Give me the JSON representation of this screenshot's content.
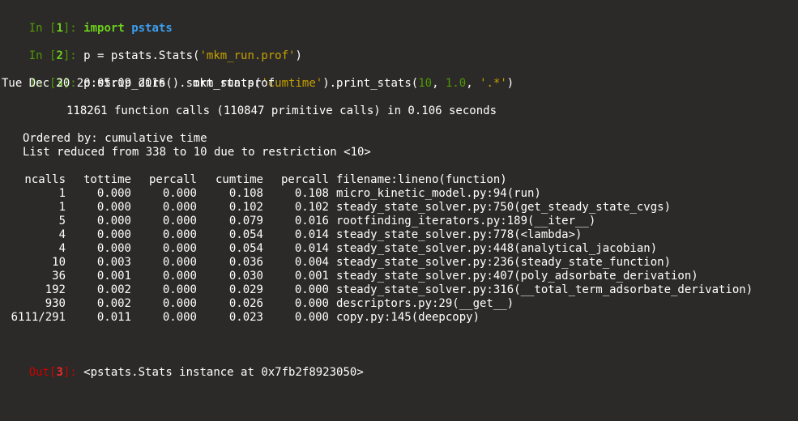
{
  "cells": [
    {
      "in_prefix": "In [",
      "in_num": "1",
      "in_suffix": "]: ",
      "kw": "import",
      "space": " ",
      "module": "pstats"
    },
    {
      "in_prefix": "In [",
      "in_num": "2",
      "in_suffix": "]: ",
      "code_a": "p = pstats.Stats(",
      "code_str": "'mkm_run.prof'",
      "code_b": ")"
    },
    {
      "in_prefix": "In [",
      "in_num": "3",
      "in_suffix": "]: ",
      "code_a": "p.strip_dirs().sort_stats(",
      "code_str1": "'cumtime'",
      "code_b": ").print_stats(",
      "arg1": "10",
      "sep1": ", ",
      "arg2": "1.0",
      "sep2": ", ",
      "code_str2": "'.*'",
      "code_c": ")"
    }
  ],
  "output": {
    "timestamp_line": "Tue Dec 20 20:05:09 2016    mkm_run.prof",
    "summary_line": "118261 function calls (110847 primitive calls) in 0.106 seconds",
    "ordered_line": "Ordered by: cumulative time",
    "reduced_line": "List reduced from 338 to 10 due to restriction <10>",
    "headers": {
      "ncalls": "ncalls",
      "tottime": "tottime",
      "percall1": "percall",
      "cumtime": "cumtime",
      "percall2": "percall",
      "func": "filename:lineno(function)"
    },
    "rows": [
      {
        "ncalls": "1",
        "tottime": "0.000",
        "percall1": "0.000",
        "cumtime": "0.108",
        "percall2": "0.108",
        "func": "micro_kinetic_model.py:94(run)"
      },
      {
        "ncalls": "1",
        "tottime": "0.000",
        "percall1": "0.000",
        "cumtime": "0.102",
        "percall2": "0.102",
        "func": "steady_state_solver.py:750(get_steady_state_cvgs)"
      },
      {
        "ncalls": "5",
        "tottime": "0.000",
        "percall1": "0.000",
        "cumtime": "0.079",
        "percall2": "0.016",
        "func": "rootfinding_iterators.py:189(__iter__)"
      },
      {
        "ncalls": "4",
        "tottime": "0.000",
        "percall1": "0.000",
        "cumtime": "0.054",
        "percall2": "0.014",
        "func": "steady_state_solver.py:778(<lambda>)"
      },
      {
        "ncalls": "4",
        "tottime": "0.000",
        "percall1": "0.000",
        "cumtime": "0.054",
        "percall2": "0.014",
        "func": "steady_state_solver.py:448(analytical_jacobian)"
      },
      {
        "ncalls": "10",
        "tottime": "0.003",
        "percall1": "0.000",
        "cumtime": "0.036",
        "percall2": "0.004",
        "func": "steady_state_solver.py:236(steady_state_function)"
      },
      {
        "ncalls": "36",
        "tottime": "0.001",
        "percall1": "0.000",
        "cumtime": "0.030",
        "percall2": "0.001",
        "func": "steady_state_solver.py:407(poly_adsorbate_derivation)"
      },
      {
        "ncalls": "192",
        "tottime": "0.002",
        "percall1": "0.000",
        "cumtime": "0.029",
        "percall2": "0.000",
        "func": "steady_state_solver.py:316(__total_term_adsorbate_derivation)"
      },
      {
        "ncalls": "930",
        "tottime": "0.002",
        "percall1": "0.000",
        "cumtime": "0.026",
        "percall2": "0.000",
        "func": "descriptors.py:29(__get__)"
      },
      {
        "ncalls": "6111/291",
        "tottime": "0.011",
        "percall1": "0.000",
        "cumtime": "0.023",
        "percall2": "0.000",
        "func": "copy.py:145(deepcopy)"
      }
    ],
    "out_prefix": "Out[",
    "out_num": "3",
    "out_suffix": "]: ",
    "out_value": "<pstats.Stats instance at 0x7fb2f8923050>"
  },
  "colors": {
    "background": "#2c2a28",
    "prompt_in": "#4e9a06",
    "prompt_out": "#cc0000",
    "string": "#c4a000",
    "keyword": "#6ccf1c",
    "text": "#ffffff"
  }
}
